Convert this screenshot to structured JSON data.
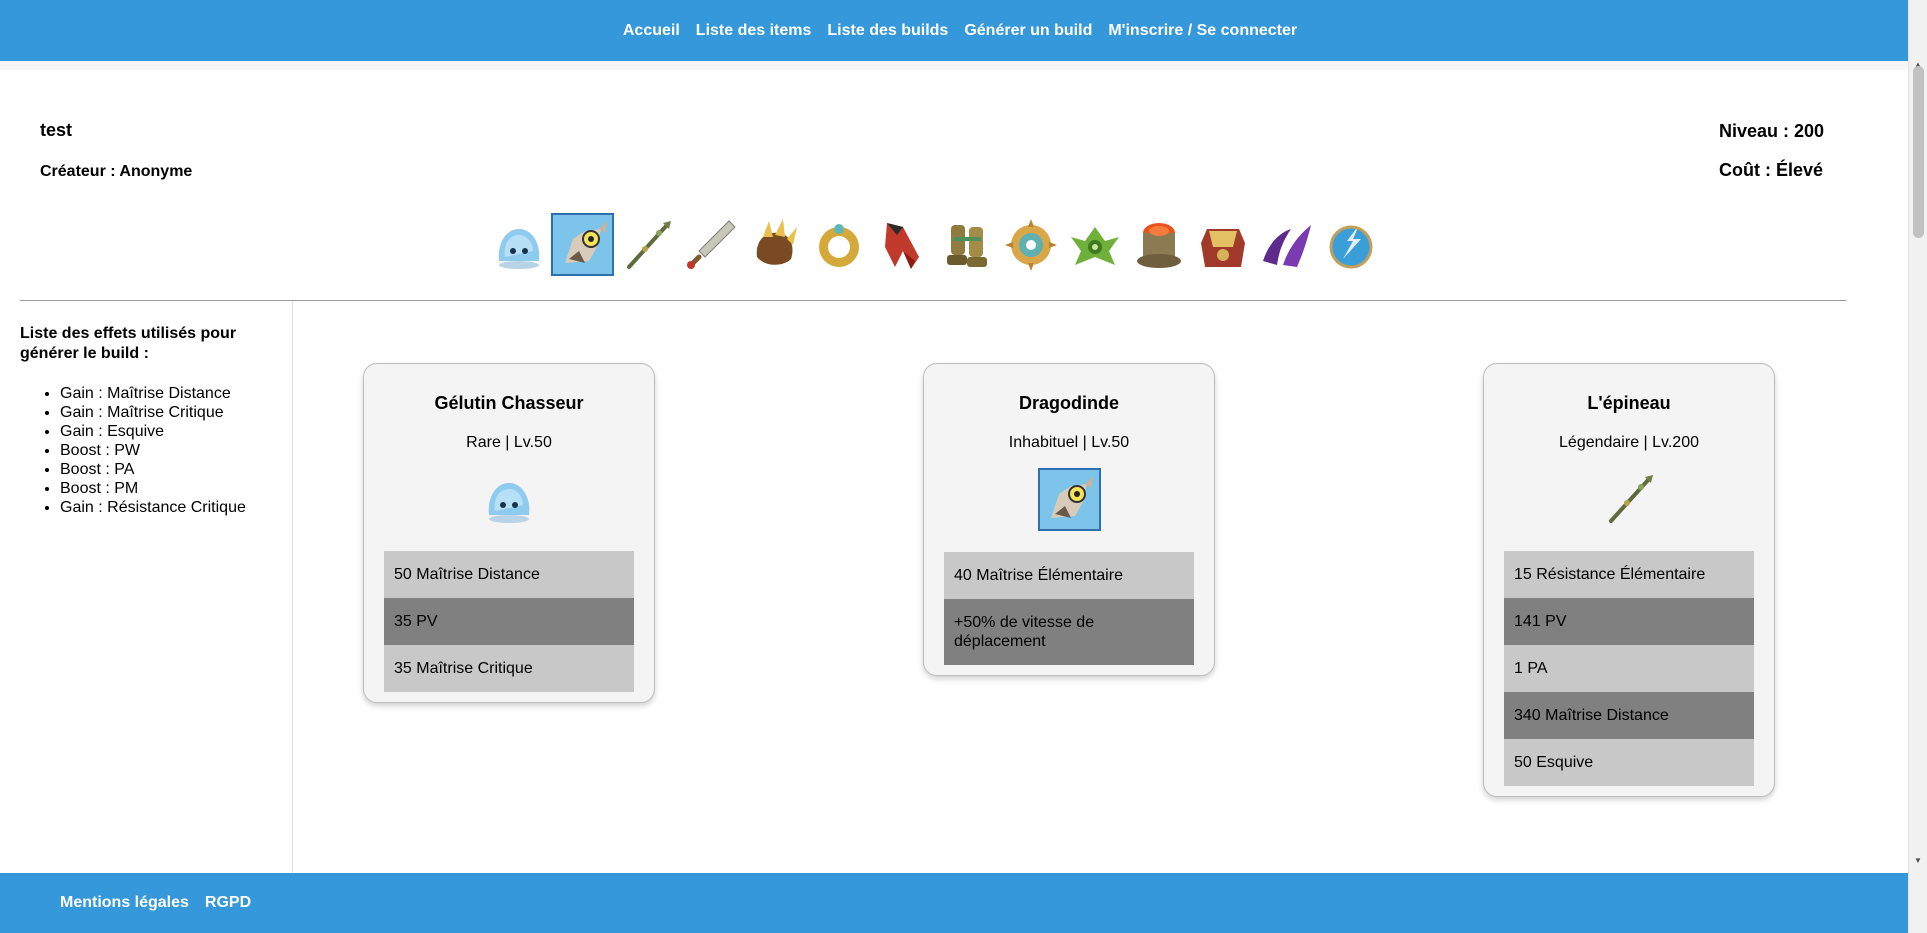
{
  "nav": {
    "items": [
      "Accueil",
      "Liste des items",
      "Liste des builds",
      "Générer un build",
      "M'inscrire / Se connecter"
    ]
  },
  "build": {
    "name": "test",
    "creator": "Créateur : Anonyme",
    "level": "Niveau : 200",
    "cost": "Coût : Élevé"
  },
  "item_bar": {
    "icons": [
      "gelutin-pet-icon",
      "dragodinde-mount-icon",
      "staff-weapon-icon",
      "dagger-icon",
      "claw-amulet-icon",
      "gold-ring-icon",
      "red-cape-icon",
      "boots-icon",
      "sun-emblem-icon",
      "green-belt-icon",
      "red-helmet-icon",
      "chest-armor-icon",
      "purple-epaulettes-icon",
      "blue-emblem-icon"
    ]
  },
  "effects": {
    "title": "Liste des effets utilisés pour générer le build :",
    "items": [
      "Gain : Maîtrise Distance",
      "Gain : Maîtrise Critique",
      "Gain : Esquive",
      "Boost : PW",
      "Boost : PA",
      "Boost : PM",
      "Gain : Résistance Critique"
    ]
  },
  "cards": [
    {
      "title": "Gélutin Chasseur",
      "sub": "Rare | Lv.50",
      "icon": "gelutin-pet-icon",
      "stats": [
        "50 Maîtrise Distance",
        "35 PV",
        "35 Maîtrise Critique"
      ]
    },
    {
      "title": "Dragodinde",
      "sub": "Inhabituel | Lv.50",
      "icon": "dragodinde-mount-icon",
      "stats": [
        "40 Maîtrise Élémentaire",
        "+50% de vitesse de déplacement"
      ]
    },
    {
      "title": "L'épineau",
      "sub": "Légendaire | Lv.200",
      "icon": "staff-weapon-icon",
      "stats": [
        "15 Résistance Élémentaire",
        "141 PV",
        "1 PA",
        "340 Maîtrise Distance",
        "50 Esquive"
      ]
    }
  ],
  "footer": {
    "links": [
      "Mentions légales",
      "RGPD"
    ]
  },
  "colors": {
    "primary": "#3498db",
    "stat_light": "#c8c8c8",
    "stat_dark": "#808080",
    "card_bg": "#f4f4f4"
  }
}
